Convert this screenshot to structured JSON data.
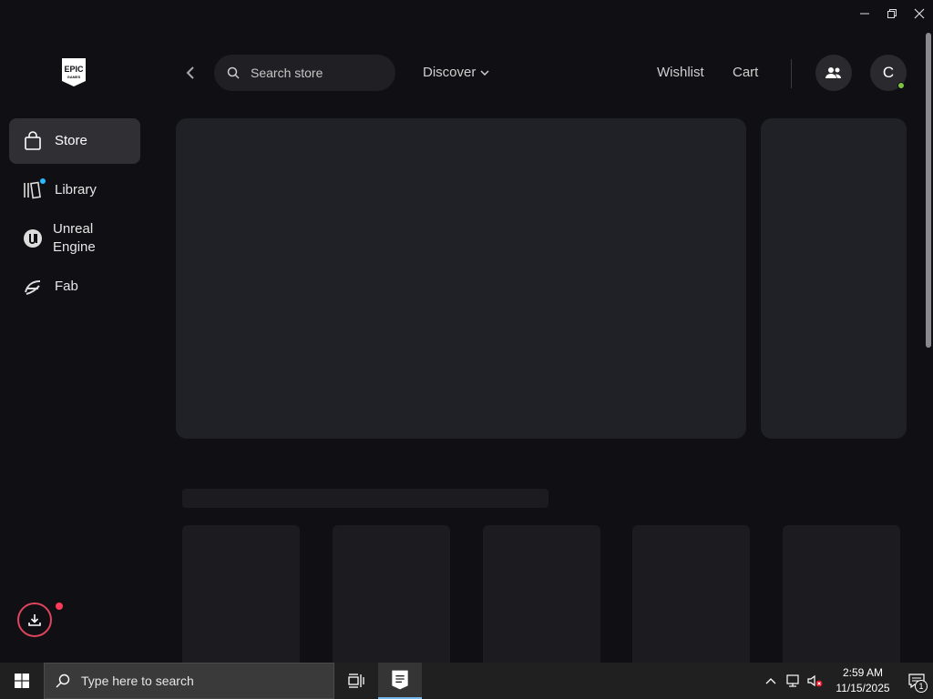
{
  "window": {
    "controls": [
      "minimize",
      "restore",
      "close"
    ]
  },
  "logo": {
    "text_top": "EPIC",
    "text_bottom": "GAMES"
  },
  "sidebar": {
    "items": [
      {
        "label": "Store",
        "icon": "shopping-bag-icon",
        "active": true
      },
      {
        "label": "Library",
        "icon": "library-icon",
        "badge": "blue-dot"
      },
      {
        "label": "Unreal\nEngine",
        "icon": "unreal-engine-icon"
      },
      {
        "label": "Fab",
        "icon": "fab-icon"
      }
    ]
  },
  "topbar": {
    "search_placeholder": "Search store",
    "discover_label": "Discover",
    "wishlist_label": "Wishlist",
    "cart_label": "Cart",
    "avatar_initial": "C"
  },
  "colors": {
    "background": "#101014",
    "placeholder": "#202027",
    "active_nav": "#303034",
    "accent_blue": "#26bbff",
    "online_green": "#7cc341",
    "download_red": "#e0445c"
  },
  "taskbar": {
    "search_placeholder": "Type here to search",
    "time": "2:59 AM",
    "date": "11/15/2025",
    "notification_count": "1"
  }
}
